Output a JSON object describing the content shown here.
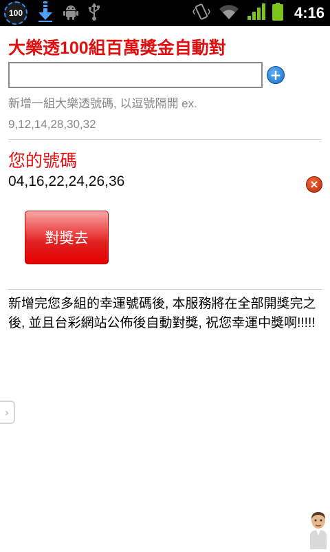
{
  "status_bar": {
    "battery_level": "100",
    "time": "4:16",
    "icons": [
      "battery-percent-icon",
      "download-icon",
      "android-debug-icon",
      "usb-icon",
      "vibrate-icon",
      "wifi-icon",
      "signal-icon",
      "battery-icon"
    ]
  },
  "header": {
    "title": "大樂透100組百萬獎金自動對"
  },
  "add_form": {
    "input_value": "",
    "input_placeholder": "",
    "add_icon": "plus-circle-icon",
    "hint_line1": "新增一組大樂透號碼, 以逗號隔開 ex.",
    "hint_line2": "9,12,14,28,30,32"
  },
  "numbers_section": {
    "title": "您的號碼",
    "entries": [
      "04,16,22,24,26,36"
    ],
    "remove_icon": "close-circle-icon"
  },
  "check_button": {
    "label": "對獎去"
  },
  "info": {
    "text": "新增完您多組的幸運號碼後, 本服務將在全部開獎完之後, 並且台彩網站公佈後自動對獎, 祝您幸運中獎啊!!!!!"
  },
  "colors": {
    "accent_red": "#e01010",
    "button_red": "#e60000",
    "hint_gray": "#888888",
    "add_blue": "#1670c8",
    "remove_orange": "#c9400f"
  }
}
